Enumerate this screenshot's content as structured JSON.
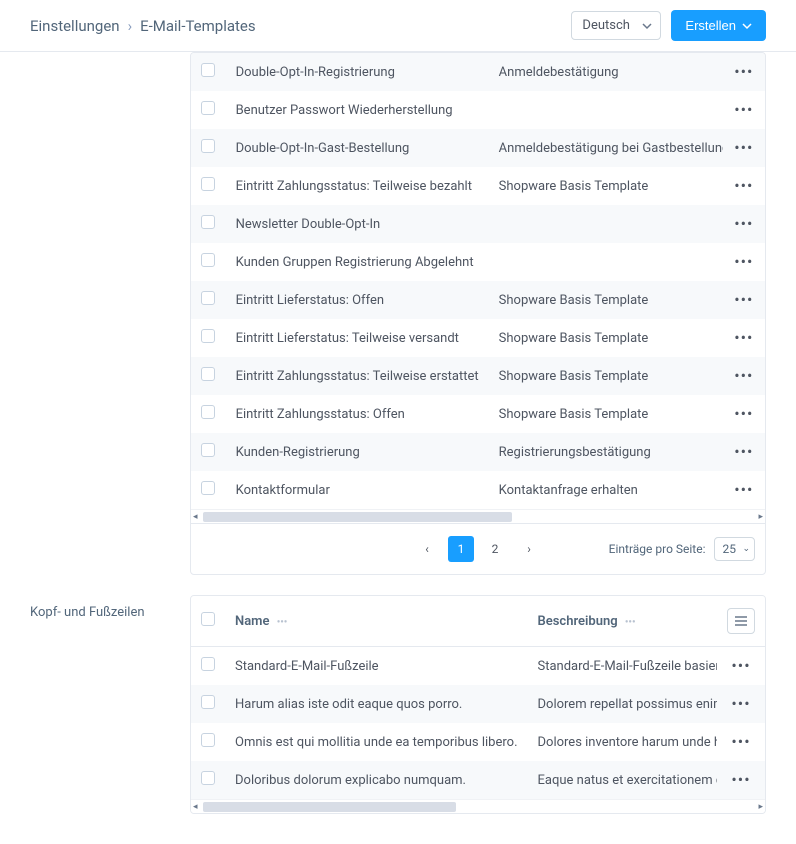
{
  "breadcrumb": {
    "settings": "Einstellungen",
    "templates": "E-Mail-Templates"
  },
  "header": {
    "language": "Deutsch",
    "create": "Erstellen"
  },
  "templates_grid": {
    "rows": [
      {
        "type": "Double-Opt-In-Registrierung",
        "desc": "Anmeldebestätigung"
      },
      {
        "type": "Benutzer Passwort Wiederherstellung",
        "desc": ""
      },
      {
        "type": "Double-Opt-In-Gast-Bestellung",
        "desc": "Anmeldebestätigung bei Gastbestellungen"
      },
      {
        "type": "Eintritt Zahlungsstatus: Teilweise bezahlt",
        "desc": "Shopware Basis Template"
      },
      {
        "type": "Newsletter Double-Opt-In",
        "desc": ""
      },
      {
        "type": "Kunden Gruppen Registrierung Abgelehnt",
        "desc": ""
      },
      {
        "type": "Eintritt Lieferstatus: Offen",
        "desc": "Shopware Basis Template"
      },
      {
        "type": "Eintritt Lieferstatus: Teilweise versandt",
        "desc": "Shopware Basis Template"
      },
      {
        "type": "Eintritt Zahlungsstatus: Teilweise erstattet",
        "desc": "Shopware Basis Template"
      },
      {
        "type": "Eintritt Zahlungsstatus: Offen",
        "desc": "Shopware Basis Template"
      },
      {
        "type": "Kunden-Registrierung",
        "desc": "Registrierungsbestätigung"
      },
      {
        "type": "Kontaktformular",
        "desc": "Kontaktanfrage erhalten"
      }
    ]
  },
  "pagination": {
    "page1": "1",
    "page2": "2",
    "per_page_label": "Einträge pro Seite:",
    "per_page_value": "25"
  },
  "footers_section": {
    "label": "Kopf- und Fußzeilen",
    "columns": {
      "name": "Name",
      "desc": "Beschreibung"
    },
    "rows": [
      {
        "name": "Standard-E-Mail-Fußzeile",
        "desc": "Standard-E-Mail-Fußzeile basierend auf den Sta"
      },
      {
        "name": "Harum alias iste odit eaque quos porro.",
        "desc": "Dolorem repellat possimus enim sunt eum et. U"
      },
      {
        "name": "Omnis est qui mollitia unde ea temporibus libero.",
        "desc": "Dolores inventore harum unde harum quia. Asp"
      },
      {
        "name": "Doloribus dolorum explicabo numquam.",
        "desc": "Eaque natus et exercitationem qui et facilis. Ne"
      }
    ]
  }
}
